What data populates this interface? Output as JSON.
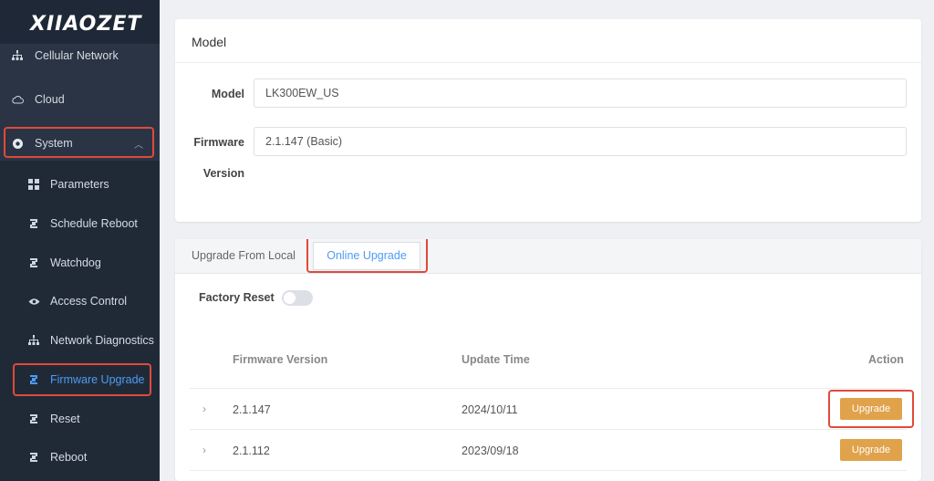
{
  "brand": {
    "logo_text": "XIIAOZET"
  },
  "sidebar": {
    "items": [
      {
        "label": "Cellular Network",
        "icon": "network-icon"
      },
      {
        "label": "Cloud",
        "icon": "cloud-icon"
      },
      {
        "label": "System",
        "icon": "gear-icon",
        "expanded": true
      }
    ],
    "sub_items": [
      {
        "label": "Parameters",
        "icon": "grid-icon"
      },
      {
        "label": "Schedule Reboot",
        "icon": "refresh-icon"
      },
      {
        "label": "Watchdog",
        "icon": "refresh-icon"
      },
      {
        "label": "Access Control",
        "icon": "eye-icon"
      },
      {
        "label": "Network Diagnostics",
        "icon": "network-icon"
      },
      {
        "label": "Firmware Upgrade",
        "icon": "refresh-icon",
        "active": true
      },
      {
        "label": "Reset",
        "icon": "refresh-icon"
      },
      {
        "label": "Reboot",
        "icon": "refresh-icon"
      }
    ]
  },
  "model_card": {
    "title": "Model",
    "model_label": "Model",
    "model_value": "LK300EW_US",
    "firmware_label_line1": "Firmware",
    "firmware_label_line2": "Version",
    "firmware_value": "2.1.147 (Basic)"
  },
  "upgrade_card": {
    "tabs": [
      "Upgrade From Local",
      "Online Upgrade"
    ],
    "active_tab": "Online Upgrade",
    "factory_reset_label": "Factory Reset",
    "factory_reset_on": false,
    "table": {
      "headers": [
        "Firmware Version",
        "Update Time",
        "Action"
      ],
      "rows": [
        {
          "version": "2.1.147",
          "time": "2024/10/11",
          "action": "Upgrade"
        },
        {
          "version": "2.1.112",
          "time": "2023/09/18",
          "action": "Upgrade"
        }
      ]
    }
  },
  "colors": {
    "accent": "#4d9cf5",
    "highlight": "#e04a3a",
    "upgrade_button": "#e0a24a",
    "sidebar_bg": "#2a3444"
  }
}
